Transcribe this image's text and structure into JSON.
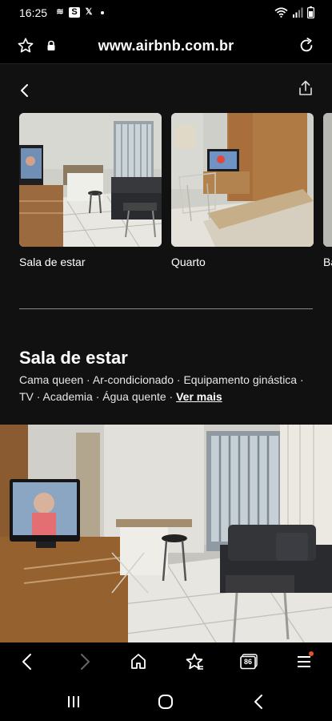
{
  "status_bar": {
    "time": "16:25",
    "app_icons": [
      {
        "icon": "stacked-chevrons-icon",
        "glyph": "≋",
        "boxed": false
      },
      {
        "icon": "s-app-icon",
        "glyph": "S",
        "boxed": true
      },
      {
        "icon": "x-app-icon",
        "glyph": "𝕏",
        "boxed": false
      }
    ]
  },
  "browser": {
    "url": "www.airbnb.com.br",
    "tab_count": "86"
  },
  "gallery": {
    "items": [
      {
        "label": "Sala de estar"
      },
      {
        "label": "Quarto"
      },
      {
        "label": "Ba"
      }
    ]
  },
  "section": {
    "title": "Sala de estar",
    "amenities_text": "Cama queen · Ar-condicionado · Equipamento ginástica · TV · Academia · Água quente · ",
    "more_link": "Ver mais"
  },
  "colors": {
    "page_bg": "#111111",
    "accent_dot": "#e8512e"
  }
}
